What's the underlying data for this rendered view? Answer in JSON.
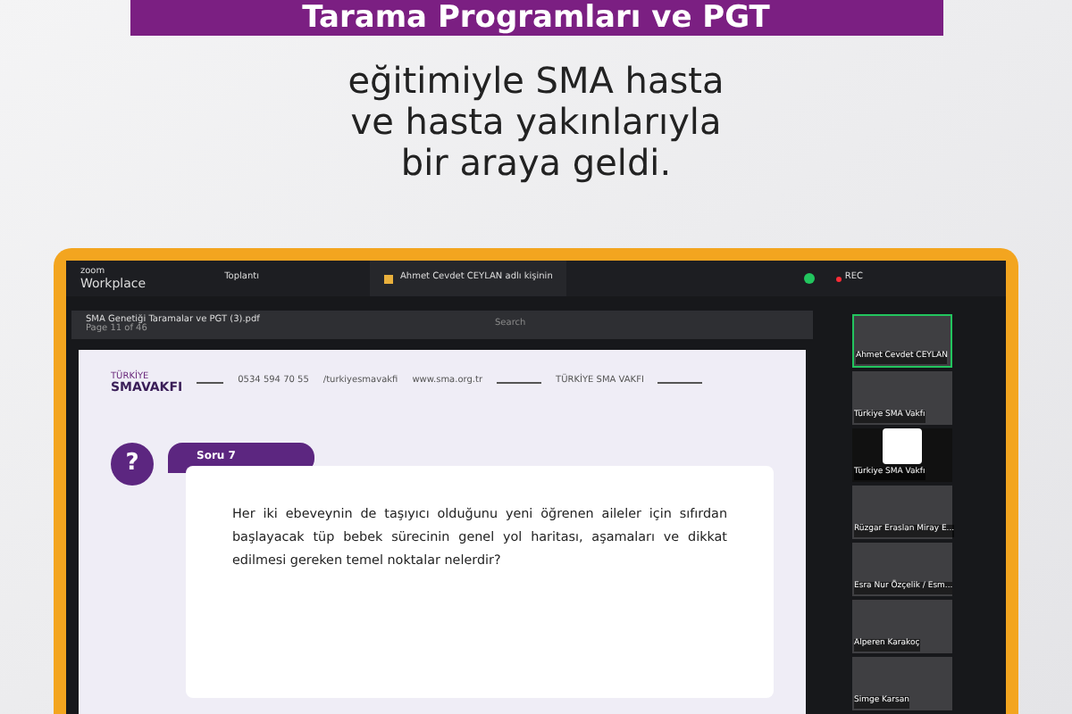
{
  "banner": {
    "title": "Tarama Programları ve PGT"
  },
  "subtitle": [
    "eğitimiyle SMA hasta",
    "ve hasta yakınlarıyla",
    "bir araya geldi."
  ],
  "zoom": {
    "brand_small": "zoom",
    "brand": "Workplace",
    "meeting_tab": "Toplantı",
    "share_tab": "Ahmet Cevdet CEYLAN adlı kişinin",
    "rec": "REC",
    "pdf_name": "SMA Genetiği Taramalar ve PGT (3).pdf",
    "pdf_page": "Page 11 of 46",
    "search_placeholder": "Search"
  },
  "slide": {
    "logo": "SMAVAKFI",
    "logo_small": "TÜRKİYE",
    "contacts": [
      "0534 594 70 55",
      "/turkiyesmavakfi",
      "www.sma.org.tr"
    ],
    "org": "TÜRKİYE SMA VAKFI",
    "question_label": "Soru 7",
    "question_mark": "?",
    "question": "Her iki ebeveynin de taşıyıcı olduğunu yeni öğrenen aileler için sıfırdan başlayacak tüp bebek sürecinin genel yol haritası, aşamaları ve dikkat edilmesi gereken temel noktalar nelerdir?"
  },
  "participants": [
    {
      "name": "Ahmet Cevdet CEYLAN",
      "kind": "video",
      "speaking": true
    },
    {
      "name": "Türkiye SMA Vakfı",
      "kind": "video",
      "speaking": false
    },
    {
      "name": "Türkiye SMA Vakfı",
      "kind": "logo",
      "speaking": false
    },
    {
      "name": "Rüzgar Eraslan Miray E...",
      "kind": "video",
      "speaking": false
    },
    {
      "name": "Esra Nur Özçelik / Esm...",
      "kind": "video",
      "speaking": false
    },
    {
      "name": "Alperen Karakoç",
      "kind": "video",
      "speaking": false
    },
    {
      "name": "Simge Karsan",
      "kind": "video",
      "speaking": false
    }
  ]
}
